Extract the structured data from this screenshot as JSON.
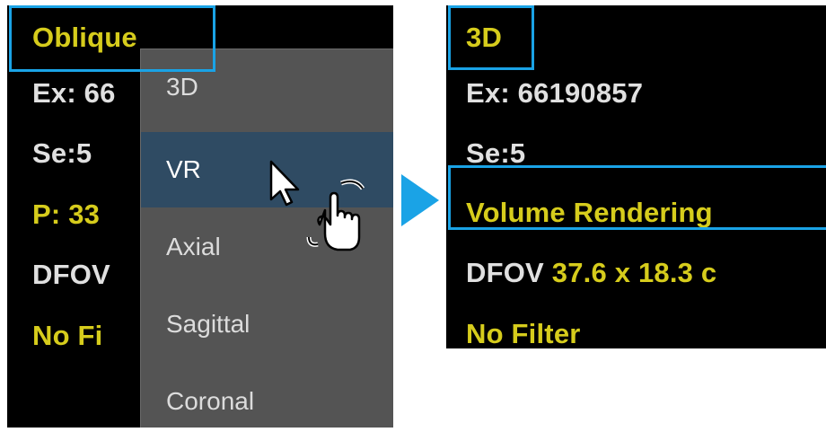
{
  "before": {
    "title": "Oblique",
    "ex_partial": "Ex: 66",
    "se": "Se:5",
    "p_partial": "P: 33",
    "dfov_partial": "DFOV",
    "filter_partial": "No Fi",
    "menu_items": [
      "3D",
      "VR",
      "Axial",
      "Sagittal",
      "Coronal"
    ],
    "selected_item": "VR"
  },
  "after": {
    "title": "3D",
    "ex": "Ex: 66190857",
    "se": "Se:5",
    "rendering": "Volume Rendering",
    "dfov_label": "DFOV",
    "dfov_value": "37.6 x 18.3 c",
    "filter": "No Filter"
  },
  "colors": {
    "highlight": "#1aa3e6",
    "overlay_yellow": "#d6cc1c",
    "menu_selected": "#2f4b63"
  },
  "icons": [
    "arrow-right-icon",
    "hand-cursor-icon"
  ]
}
